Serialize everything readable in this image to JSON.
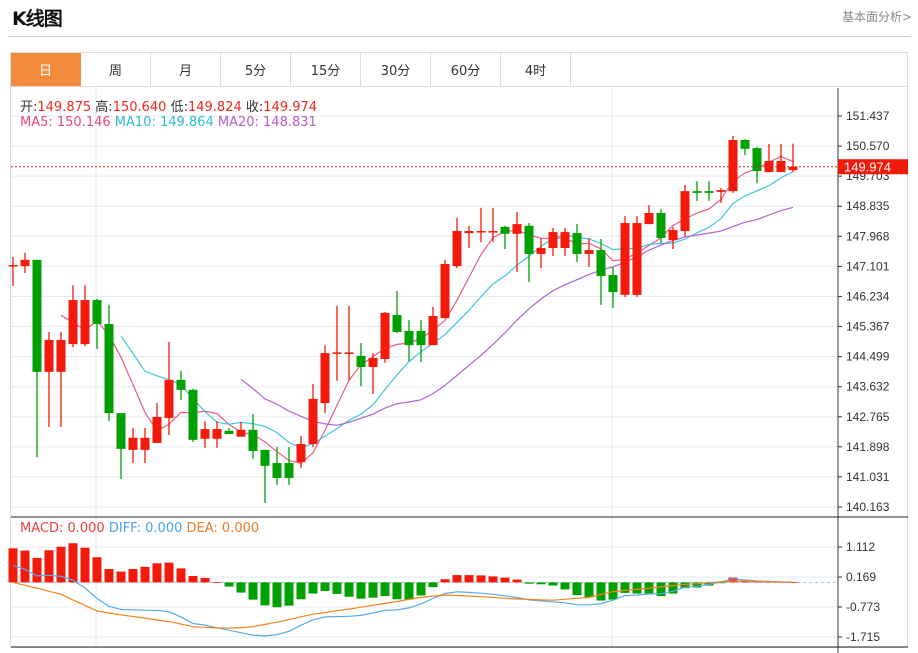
{
  "header": {
    "title": "K线图",
    "link": "基本面分析>"
  },
  "tabs": [
    {
      "label": "日",
      "active": true
    },
    {
      "label": "周"
    },
    {
      "label": "月"
    },
    {
      "label": "5分"
    },
    {
      "label": "15分"
    },
    {
      "label": "30分"
    },
    {
      "label": "60分"
    },
    {
      "label": "4时"
    }
  ],
  "info": {
    "open_label": "开:",
    "open": "149.875",
    "high_label": "高:",
    "high": "150.640",
    "low_label": "低:",
    "low": "149.824",
    "close_label": "收:",
    "close": "149.974",
    "ma5": "MA5: 150.146",
    "ma10": "MA10: 149.864",
    "ma20": "MA20: 148.831"
  },
  "macd_info": {
    "macd": "MACD: 0.000",
    "diff": "DIFF: 0.000",
    "dea": "DEA: 0.000"
  },
  "colors": {
    "up": "#f21a0a",
    "down": "#00a000",
    "ma5": "#ee5a88",
    "ma10": "#3cc8de",
    "ma20": "#b462d0",
    "diff": "#5aaaf0",
    "dea": "#f58220",
    "tab_active": "#f28c3c"
  },
  "chart_data": [
    {
      "type": "candlestick",
      "price_ticks": [
        "151.437",
        "150.570",
        "149.703",
        "148.835",
        "147.968",
        "147.101",
        "146.234",
        "145.367",
        "144.499",
        "143.632",
        "142.765",
        "141.898",
        "141.031",
        "140.163"
      ],
      "current_price": "149.974",
      "ohlc": [
        [
          147.11,
          147.37,
          146.54,
          147.14
        ],
        [
          147.11,
          147.49,
          146.91,
          147.29
        ],
        [
          147.29,
          147.29,
          141.6,
          144.06
        ],
        [
          144.06,
          145.21,
          142.47,
          144.98
        ],
        [
          144.06,
          145.21,
          142.47,
          144.98
        ],
        [
          144.86,
          146.56,
          144.77,
          146.13
        ],
        [
          144.86,
          146.56,
          144.8,
          146.13
        ],
        [
          146.13,
          146.16,
          144.72,
          145.44
        ],
        [
          145.44,
          145.99,
          142.64,
          142.87
        ],
        [
          142.87,
          142.87,
          140.97,
          141.84
        ],
        [
          141.81,
          142.44,
          141.43,
          142.16
        ],
        [
          141.81,
          142.44,
          141.43,
          142.16
        ],
        [
          142.01,
          143.16,
          142.01,
          142.76
        ],
        [
          142.73,
          144.92,
          142.24,
          143.83
        ],
        [
          143.83,
          144.09,
          143.25,
          143.54
        ],
        [
          143.54,
          143.57,
          142.04,
          142.1
        ],
        [
          142.13,
          142.64,
          141.87,
          142.41
        ],
        [
          142.13,
          142.64,
          141.87,
          142.41
        ],
        [
          142.36,
          142.44,
          142.27,
          142.27
        ],
        [
          142.19,
          142.61,
          142.19,
          142.39
        ],
        [
          142.39,
          142.84,
          141.55,
          141.78
        ],
        [
          141.81,
          141.81,
          140.28,
          141.35
        ],
        [
          141.43,
          141.89,
          140.8,
          141.0
        ],
        [
          141.43,
          141.89,
          140.8,
          141.0
        ],
        [
          141.46,
          142.21,
          141.29,
          141.98
        ],
        [
          141.98,
          143.71,
          141.89,
          143.28
        ],
        [
          143.16,
          144.83,
          142.87,
          144.6
        ],
        [
          144.6,
          145.96,
          143.8,
          144.62
        ],
        [
          144.6,
          145.96,
          143.83,
          144.62
        ],
        [
          144.52,
          144.89,
          143.65,
          144.2
        ],
        [
          144.2,
          144.6,
          143.42,
          144.46
        ],
        [
          144.43,
          145.79,
          144.32,
          145.76
        ],
        [
          145.7,
          146.39,
          145.18,
          145.21
        ],
        [
          145.24,
          145.55,
          144.37,
          144.83
        ],
        [
          145.24,
          145.55,
          144.34,
          144.83
        ],
        [
          144.83,
          145.93,
          144.83,
          145.67
        ],
        [
          145.61,
          147.29,
          145.61,
          147.17
        ],
        [
          147.11,
          148.5,
          147.05,
          148.12
        ],
        [
          148.06,
          148.27,
          147.63,
          148.12
        ],
        [
          148.09,
          148.79,
          147.8,
          148.12
        ],
        [
          148.09,
          148.79,
          147.8,
          148.12
        ],
        [
          148.24,
          148.27,
          147.6,
          148.04
        ],
        [
          148.04,
          148.67,
          146.94,
          148.32
        ],
        [
          148.27,
          148.35,
          146.65,
          147.46
        ],
        [
          147.46,
          147.92,
          147.05,
          147.63
        ],
        [
          147.63,
          148.21,
          147.4,
          148.09
        ],
        [
          147.63,
          148.21,
          147.4,
          148.09
        ],
        [
          148.06,
          148.32,
          147.23,
          147.46
        ],
        [
          147.46,
          147.92,
          147.08,
          147.57
        ],
        [
          147.57,
          147.89,
          145.99,
          146.82
        ],
        [
          146.85,
          147.08,
          145.9,
          146.36
        ],
        [
          146.28,
          148.55,
          146.22,
          148.35
        ],
        [
          146.28,
          148.55,
          146.22,
          148.35
        ],
        [
          148.32,
          148.87,
          148.32,
          148.64
        ],
        [
          148.64,
          148.76,
          147.78,
          147.92
        ],
        [
          147.86,
          148.24,
          147.6,
          148.15
        ],
        [
          148.12,
          149.45,
          147.95,
          149.27
        ],
        [
          149.27,
          149.56,
          148.99,
          149.22
        ],
        [
          149.27,
          149.56,
          148.99,
          149.22
        ],
        [
          149.25,
          149.36,
          148.93,
          149.3
        ],
        [
          149.27,
          150.86,
          149.22,
          150.745
        ],
        [
          150.745,
          150.77,
          150.31,
          150.49
        ],
        [
          150.51,
          150.54,
          149.5,
          149.85
        ],
        [
          149.82,
          150.63,
          149.82,
          150.14
        ],
        [
          149.82,
          150.63,
          149.82,
          150.14
        ],
        [
          149.875,
          150.64,
          149.824,
          149.974
        ]
      ],
      "moving_averages": [
        {
          "name": "MA5",
          "period": 5
        },
        {
          "name": "MA10",
          "period": 10
        },
        {
          "name": "MA20",
          "period": 20
        }
      ]
    },
    {
      "type": "bar",
      "name": "MACD",
      "ticks": [
        "1.112",
        "0.169",
        "-0.773",
        "-1.715"
      ],
      "macd": [
        1.07,
        1.0,
        0.77,
        1.01,
        1.12,
        1.23,
        1.09,
        0.79,
        0.42,
        0.34,
        0.42,
        0.49,
        0.6,
        0.62,
        0.44,
        0.2,
        0.14,
        0.01,
        -0.13,
        -0.32,
        -0.54,
        -0.72,
        -0.78,
        -0.73,
        -0.53,
        -0.35,
        -0.27,
        -0.36,
        -0.45,
        -0.51,
        -0.48,
        -0.43,
        -0.53,
        -0.54,
        -0.41,
        -0.15,
        0.1,
        0.23,
        0.23,
        0.22,
        0.19,
        0.15,
        0.09,
        -0.04,
        -0.06,
        -0.1,
        -0.22,
        -0.4,
        -0.47,
        -0.57,
        -0.54,
        -0.33,
        -0.35,
        -0.36,
        -0.43,
        -0.35,
        -0.18,
        -0.16,
        -0.1,
        -0.01,
        0.15,
        0.07,
        0.03,
        0.02,
        0.02,
        0.01
      ],
      "dea": [
        0.0,
        -0.09,
        -0.18,
        -0.28,
        -0.37,
        -0.55,
        -0.72,
        -0.9,
        -0.96,
        -1.02,
        -1.07,
        -1.12,
        -1.18,
        -1.23,
        -1.31,
        -1.39,
        -1.41,
        -1.43,
        -1.44,
        -1.42,
        -1.39,
        -1.32,
        -1.25,
        -1.17,
        -1.08,
        -1.0,
        -0.95,
        -0.89,
        -0.84,
        -0.78,
        -0.72,
        -0.66,
        -0.6,
        -0.53,
        -0.47,
        -0.43,
        -0.4,
        -0.41,
        -0.43,
        -0.45,
        -0.47,
        -0.5,
        -0.52,
        -0.53,
        -0.55,
        -0.56,
        -0.53,
        -0.5,
        -0.47,
        -0.38,
        -0.29,
        -0.25,
        -0.22,
        -0.18,
        -0.14,
        -0.1,
        -0.06,
        -0.04,
        -0.01,
        0.02,
        0.04,
        0.04,
        0.03,
        0.02,
        0.01,
        0.0
      ]
    }
  ]
}
